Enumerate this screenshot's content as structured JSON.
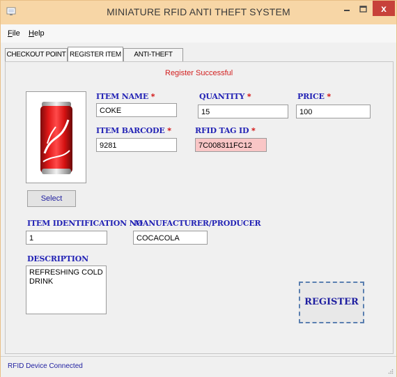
{
  "window": {
    "title": "MINIATURE RFID ANTI THEFT SYSTEM",
    "minimize_icon": "minimize-icon",
    "maximize_icon": "maximize-icon",
    "close_label": "x"
  },
  "menu": [
    {
      "label": "File",
      "accelerator": "F"
    },
    {
      "label": "Help",
      "accelerator": "H"
    }
  ],
  "tabs": [
    {
      "label": "CHECKOUT POINT",
      "active": false
    },
    {
      "label": "REGISTER ITEM",
      "active": true
    },
    {
      "label": "ANTI-THEFT POINT",
      "active": false
    }
  ],
  "form": {
    "status_message": "Register Successful",
    "select_button": "Select",
    "item_name": {
      "label": "ITEM NAME",
      "value": "COKE",
      "required": true
    },
    "quantity": {
      "label": "QUANTITY",
      "value": "15",
      "required": true
    },
    "price": {
      "label": "PRICE",
      "value": "100",
      "required": true
    },
    "item_barcode": {
      "label": "ITEM BARCODE",
      "value": "9281",
      "required": true
    },
    "rfid_tag_id": {
      "label": "RFID TAG ID",
      "value": "7C008311FC12",
      "required": true
    },
    "item_identification_no": {
      "label": "ITEM IDENTIFICATION NO",
      "value": "1"
    },
    "manufacturer": {
      "label": "MANUFACTURER/PRODUCER",
      "value": "COCACOLA"
    },
    "description": {
      "label": "DESCRIPTION",
      "value": "REFRESHING COLD DRINK"
    },
    "register_button": "REGISTER",
    "required_mark": "*"
  },
  "statusbar": {
    "text": "RFID Device Connected"
  },
  "colors": {
    "titlebar": "#f7d6a6",
    "label_blue": "#2323b5",
    "required_red": "#d00000",
    "rfid_highlight": "#f9c6c6",
    "close_red": "#c7413a"
  }
}
